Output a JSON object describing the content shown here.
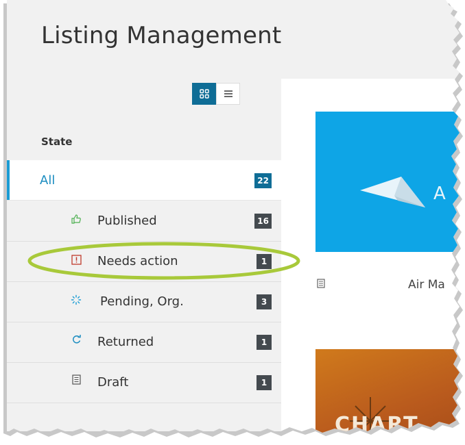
{
  "title": "Listing Management",
  "view_toggle": {
    "grid_icon": "grid-icon",
    "list_icon": "list-icon",
    "active": "grid"
  },
  "filter": {
    "heading": "State",
    "items": [
      {
        "label": "All",
        "count": "22",
        "icon": null
      },
      {
        "label": "Published",
        "count": "16",
        "icon": "thumbs-up-icon"
      },
      {
        "label": "Needs action",
        "count": "1",
        "icon": "alert-icon"
      },
      {
        "label": "Pending, Org.",
        "count": "3",
        "icon": "spinner-icon"
      },
      {
        "label": "Returned",
        "count": "1",
        "icon": "refresh-icon"
      },
      {
        "label": "Draft",
        "count": "1",
        "icon": "document-icon"
      }
    ]
  },
  "listings": [
    {
      "title": "Air Ma",
      "icon": "paper-plane-icon",
      "color": "#0ea5e6"
    },
    {
      "title": "CHART",
      "color": "#c4661a"
    }
  ],
  "colors": {
    "accent": "#1a9cd4",
    "toggle_active": "#0f6d96",
    "badge": "#444a4f",
    "highlight": "#a8c93a"
  }
}
